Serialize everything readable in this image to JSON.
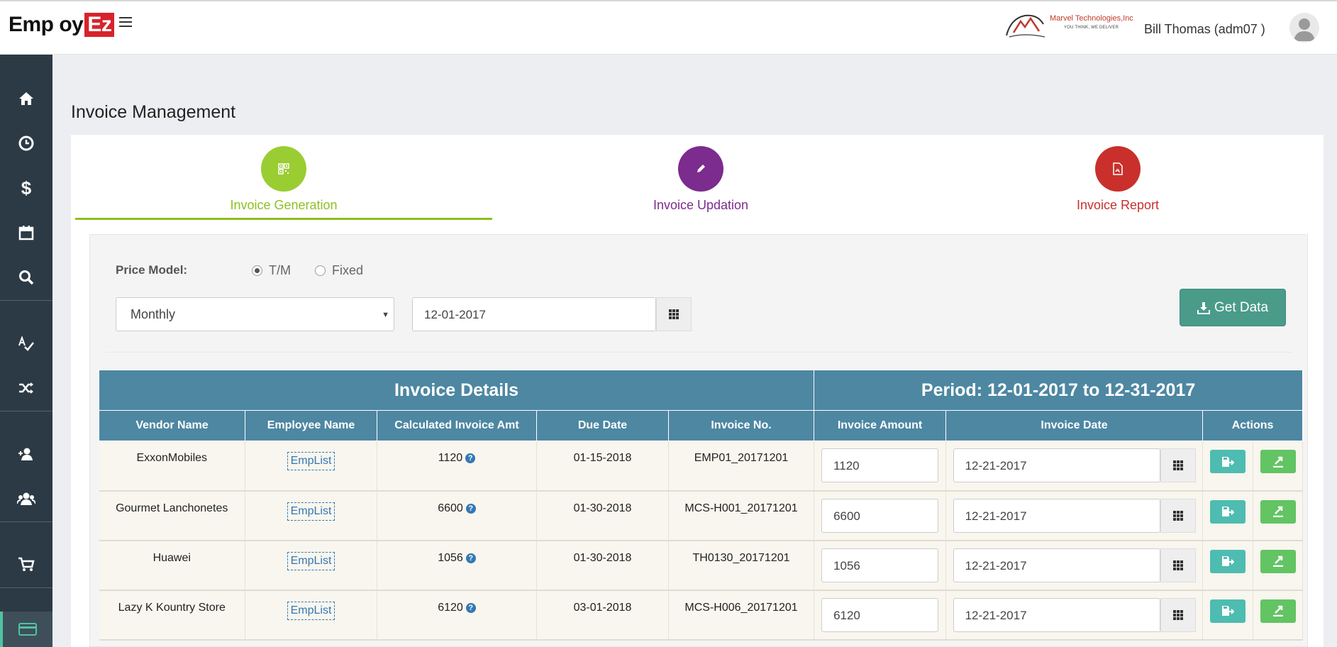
{
  "header": {
    "logo_main": "Emp oy",
    "logo_accent": "Ez",
    "company_name": "Marvel Technologies,Inc",
    "company_tagline": "YOU THINK, WE DELIVER",
    "user_name": "Bill Thomas (adm07 )"
  },
  "sidebar": {
    "items": [
      {
        "icon": "home-icon"
      },
      {
        "icon": "clock-icon"
      },
      {
        "icon": "dollar-icon"
      },
      {
        "icon": "calendar-icon"
      },
      {
        "icon": "search-icon"
      },
      {
        "icon": "spellcheck-icon"
      },
      {
        "icon": "shuffle-icon"
      },
      {
        "icon": "add-user-icon"
      },
      {
        "icon": "users-icon"
      },
      {
        "icon": "cart-icon"
      },
      {
        "icon": "credit-card-icon"
      }
    ]
  },
  "page": {
    "title": "Invoice Management"
  },
  "tabs": [
    {
      "label": "Invoice Generation",
      "color": "#8cc21e"
    },
    {
      "label": "Invoice Updation",
      "color": "#7c2b8e"
    },
    {
      "label": "Invoice Report",
      "color": "#c9302c"
    }
  ],
  "filters": {
    "price_model_label": "Price Model:",
    "radio_tm": "T/M",
    "radio_fixed": "Fixed",
    "selected_price_model": "T/M",
    "period_select": "Monthly",
    "start_date": "12-01-2017",
    "get_data_label": "Get Data"
  },
  "table": {
    "group_left": "Invoice Details",
    "group_right": "Period: 12-01-2017 to 12-31-2017",
    "columns": [
      "Vendor Name",
      "Employee Name",
      "Calculated Invoice Amt",
      "Due Date",
      "Invoice No.",
      "Invoice Amount",
      "Invoice Date",
      "Actions"
    ],
    "rows": [
      {
        "vendor": "ExxonMobiles",
        "employee": "EmpList",
        "calc_amt": "1120",
        "due_date": "01-15-2018",
        "invoice_no": "EMP01_20171201",
        "invoice_amount": "1120",
        "invoice_date": "12-21-2017"
      },
      {
        "vendor": "Gourmet Lanchonetes",
        "employee": "EmpList",
        "calc_amt": "6600",
        "due_date": "01-30-2018",
        "invoice_no": "MCS-H001_20171201",
        "invoice_amount": "6600",
        "invoice_date": "12-21-2017"
      },
      {
        "vendor": "Huawei",
        "employee": "EmpList",
        "calc_amt": "1056",
        "due_date": "01-30-2018",
        "invoice_no": "TH0130_20171201",
        "invoice_amount": "1056",
        "invoice_date": "12-21-2017"
      },
      {
        "vendor": "Lazy K Kountry Store",
        "employee": "EmpList",
        "calc_amt": "6120",
        "due_date": "03-01-2018",
        "invoice_no": "MCS-H006_20171201",
        "invoice_amount": "6120",
        "invoice_date": "12-21-2017"
      }
    ]
  }
}
